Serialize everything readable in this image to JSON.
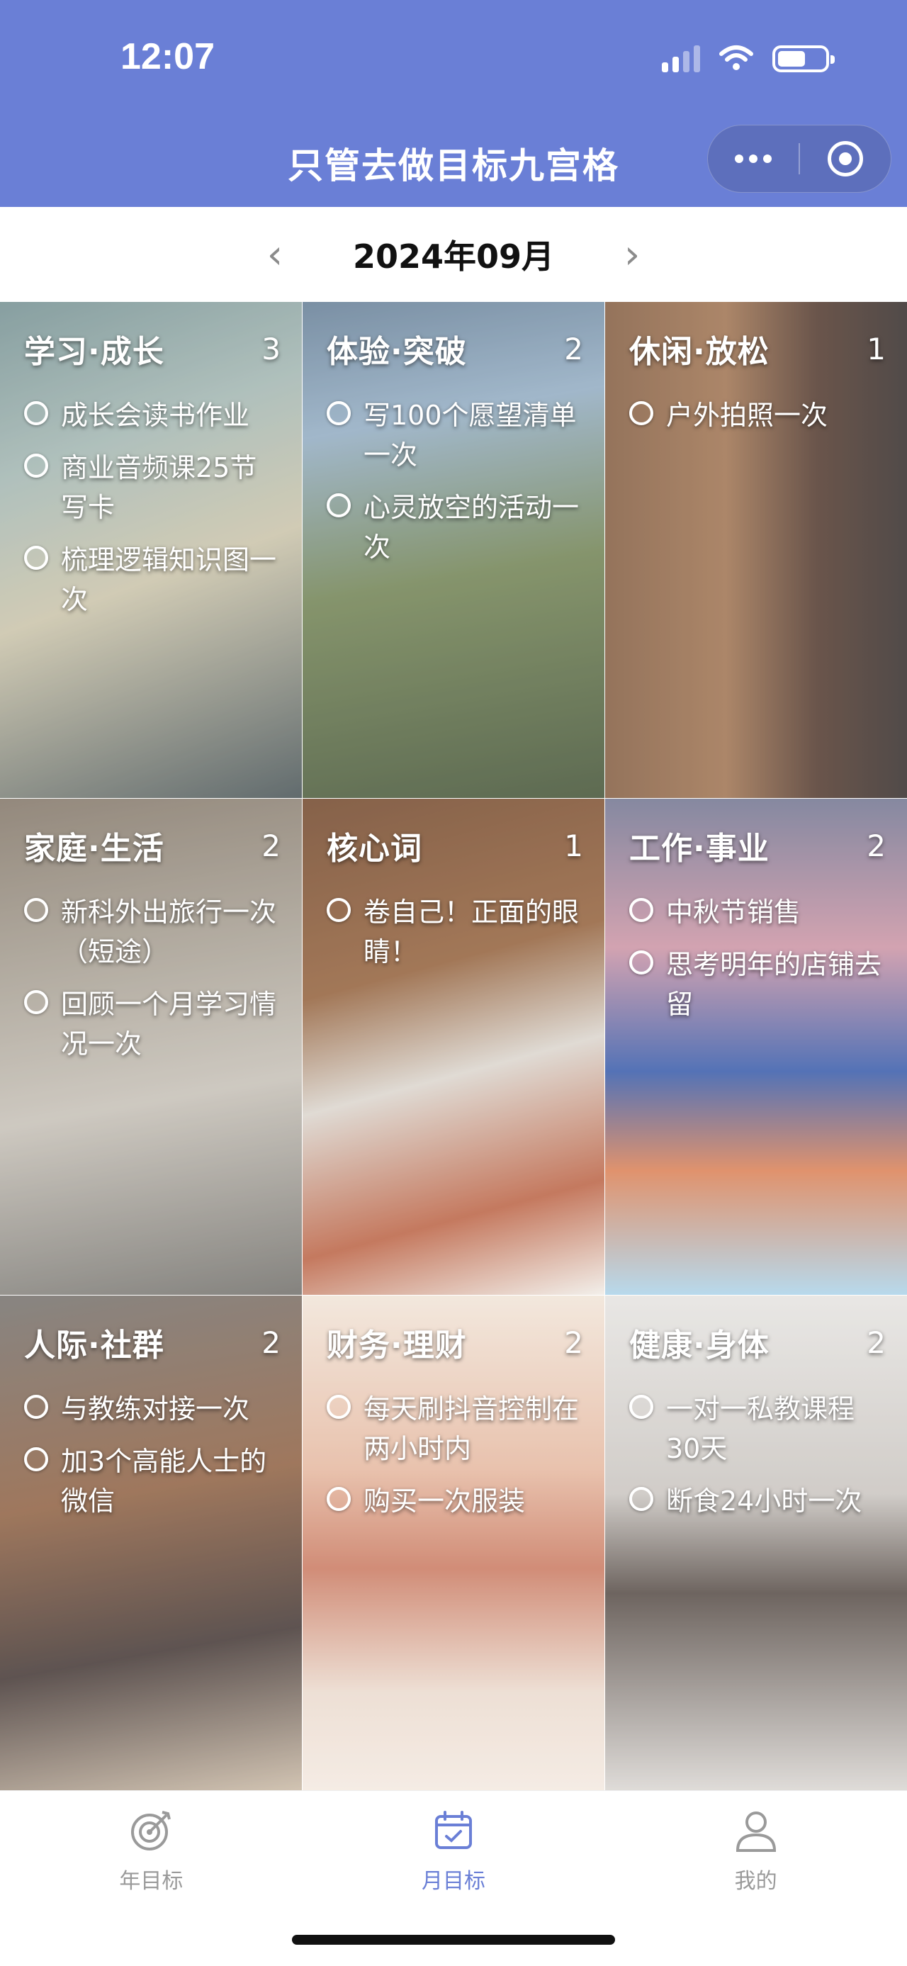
{
  "status": {
    "time": "12:07"
  },
  "nav": {
    "title": "只管去做目标九宫格"
  },
  "month": {
    "label": "2024年09月",
    "prev": "‹",
    "next": "›"
  },
  "grid": [
    {
      "title": "学习·成长",
      "count": "3",
      "goals": [
        "成长会读书作业",
        "商业音频课25节写卡",
        "梳理逻辑知识图一次"
      ]
    },
    {
      "title": "体验·突破",
      "count": "2",
      "goals": [
        "写100个愿望清单一次",
        "心灵放空的活动一次"
      ]
    },
    {
      "title": "休闲·放松",
      "count": "1",
      "goals": [
        "户外拍照一次"
      ]
    },
    {
      "title": "家庭·生活",
      "count": "2",
      "goals": [
        "新科外出旅行一次（短途）",
        "回顾一个月学习情况一次"
      ]
    },
    {
      "title": "核心词",
      "count": "1",
      "goals": [
        "卷自己！正面的眼睛！"
      ]
    },
    {
      "title": "工作·事业",
      "count": "2",
      "goals": [
        "中秋节销售",
        "思考明年的店铺去留"
      ]
    },
    {
      "title": "人际·社群",
      "count": "2",
      "goals": [
        "与教练对接一次",
        "加3个高能人士的微信"
      ]
    },
    {
      "title": "财务·理财",
      "count": "2",
      "goals": [
        "每天刷抖音控制在两小时内",
        "购买一次服装"
      ]
    },
    {
      "title": "健康·身体",
      "count": "2",
      "goals": [
        "一对一私教课程30天",
        "断食24小时一次"
      ]
    }
  ],
  "tabs": [
    {
      "label": "年目标",
      "icon": "target-icon",
      "active": false
    },
    {
      "label": "月目标",
      "icon": "calendar-check-icon",
      "active": true
    },
    {
      "label": "我的",
      "icon": "user-icon",
      "active": false
    }
  ],
  "colors": {
    "brand": "#6a7fd6",
    "inactive": "#9a9a9a"
  }
}
